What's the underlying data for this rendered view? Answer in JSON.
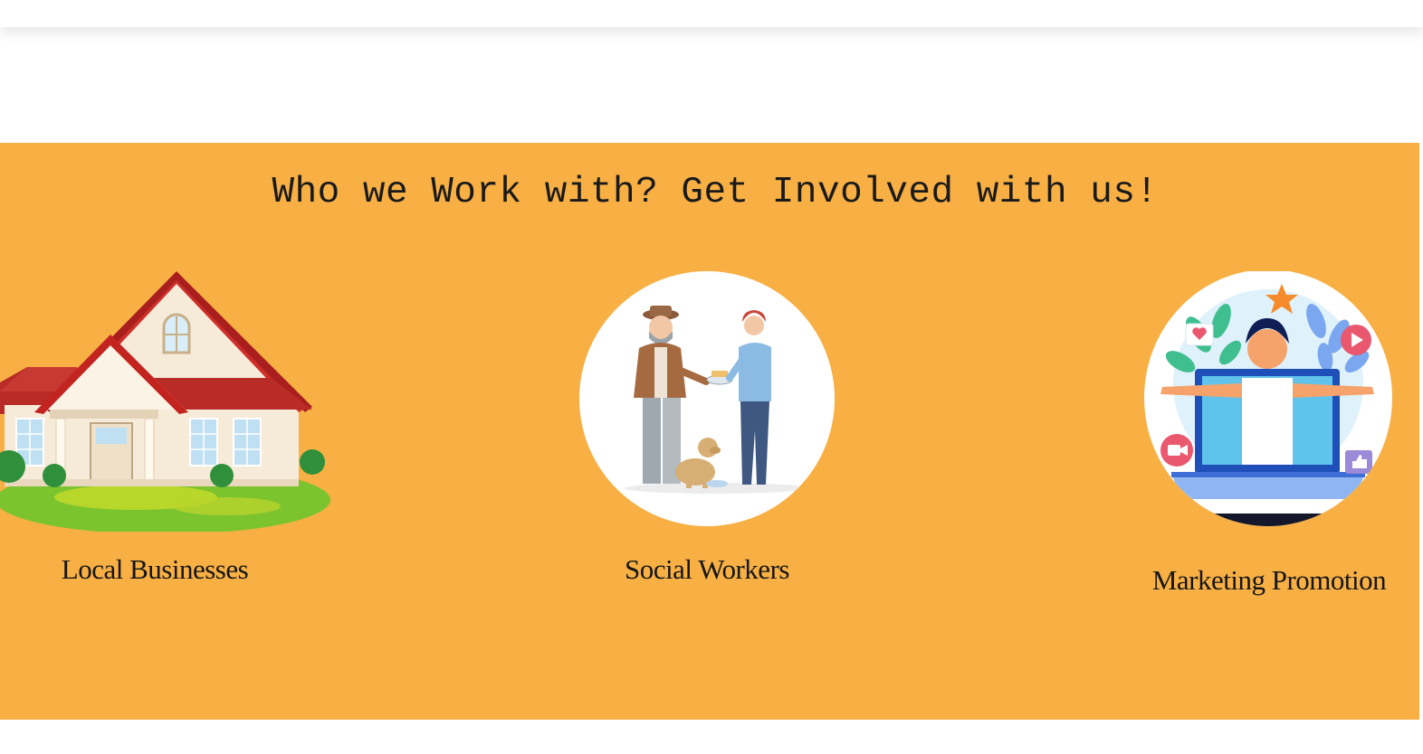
{
  "section": {
    "heading": "Who we Work with? Get Involved with us!",
    "background_color": "#F8B044"
  },
  "cards": [
    {
      "label": "Local Businesses",
      "image": "house-illustration"
    },
    {
      "label": "Social Workers",
      "image": "social-workers-illustration"
    },
    {
      "label": "Marketing Promotion",
      "image": "marketing-promotion-illustration"
    }
  ]
}
